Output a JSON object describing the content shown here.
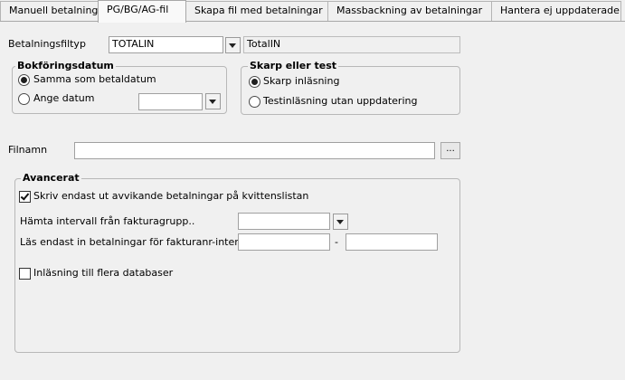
{
  "tabs": [
    {
      "label": "Manuell betalning"
    },
    {
      "label": "PG/BG/AG-fil"
    },
    {
      "label": "Skapa fil med betalningar"
    },
    {
      "label": "Massbackning av betalningar"
    },
    {
      "label": "Hantera ej uppdaterade"
    }
  ],
  "active_tab": "PG/BG/AG-fil",
  "betalningsfiltyp": {
    "label": "Betalningsfiltyp",
    "value": "TOTALIN",
    "description": "TotalIN"
  },
  "bokforingsdatum": {
    "title": "Bokföringsdatum",
    "option_same": "Samma som betaldatum",
    "option_date": "Ange datum",
    "selected": "Samma som betaldatum",
    "date_value": ""
  },
  "skarp_eller_test": {
    "title": "Skarp eller test",
    "option_live": "Skarp inläsning",
    "option_test": "Testinläsning utan uppdatering",
    "selected": "Skarp inläsning"
  },
  "filnamn": {
    "label": "Filnamn",
    "value": "",
    "browse_label": "..."
  },
  "avancerat": {
    "title": "Avancerat",
    "only_deviating_label": "Skriv endast ut avvikande betalningar på kvittenslistan",
    "only_deviating_checked": true,
    "interval_group_label": "Hämta intervall från fakturagrupp..",
    "interval_group_value": "",
    "invoice_range_label": "Läs endast in betalningar för fakturanr-intervall",
    "invoice_from": "",
    "range_separator": "-",
    "invoice_to": "",
    "multi_db_label": "Inläsning till flera databaser",
    "multi_db_checked": false
  }
}
